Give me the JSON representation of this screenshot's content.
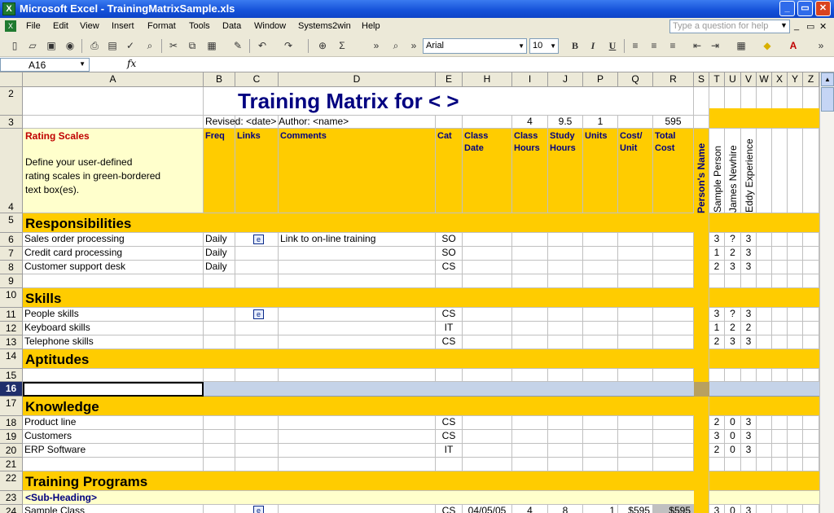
{
  "window": {
    "title": "Microsoft Excel - TrainingMatrixSample.xls"
  },
  "menu": {
    "items": [
      "File",
      "Edit",
      "View",
      "Insert",
      "Format",
      "Tools",
      "Data",
      "Window",
      "Systems2win",
      "Help"
    ],
    "help_placeholder": "Type a question for help"
  },
  "toolbar": {
    "font": "Arial",
    "size": "10",
    "bold": "B",
    "italic": "I",
    "underline": "U"
  },
  "formula_bar": {
    "name_box": "A16",
    "fx": "fx",
    "content": ""
  },
  "columns": [
    "A",
    "B",
    "C",
    "D",
    "E",
    "H",
    "I",
    "J",
    "P",
    "Q",
    "R",
    "S",
    "T",
    "U",
    "V",
    "W",
    "X",
    "Y",
    "Z"
  ],
  "sheet": {
    "title": "Training Matrix for < >",
    "revised": "Revised: <date>  Author: <name>",
    "totals_row": {
      "i": "4",
      "j": "9.5",
      "p": "1",
      "r": "595"
    },
    "rating_scales_title": "Rating Scales",
    "rating_scales_text": [
      "Define your user-defined",
      "rating scales in green-bordered",
      "text box(es)."
    ],
    "headers": {
      "freq": "Freq",
      "links": "Links",
      "comments": "Comments",
      "cat": "Cat",
      "class_date": "Class Date",
      "class_hours": "Class Hours",
      "study_hours": "Study Hours",
      "units": "Units",
      "cost_unit": "Cost/ Unit",
      "total_cost": "Total Cost"
    },
    "persons_label": "Person's Name",
    "persons": [
      "Sample Person",
      "James Newhire",
      "Eddy Experience"
    ],
    "sections": {
      "responsibilities": "Responsibilities",
      "skills": "Skills",
      "aptitudes": "Aptitudes",
      "knowledge": "Knowledge",
      "training": "Training Programs",
      "sub_heading": "<Sub-Heading>"
    },
    "rows": [
      {
        "num": "6",
        "name": "Sales order processing",
        "freq": "Daily",
        "link": true,
        "comment": "Link to on-line training",
        "cat": "SO",
        "t": "3",
        "u": "?",
        "v": "3"
      },
      {
        "num": "7",
        "name": "Credit card processing",
        "freq": "Daily",
        "link": false,
        "comment": "",
        "cat": "SO",
        "t": "1",
        "u": "2",
        "v": "3"
      },
      {
        "num": "8",
        "name": "Customer support desk",
        "freq": "Daily",
        "link": false,
        "comment": "",
        "cat": "CS",
        "t": "2",
        "u": "3",
        "v": "3"
      },
      {
        "num": "11",
        "name": "People skills",
        "freq": "",
        "link": true,
        "comment": "",
        "cat": "CS",
        "t": "3",
        "u": "?",
        "v": "3"
      },
      {
        "num": "12",
        "name": "Keyboard skills",
        "freq": "",
        "link": false,
        "comment": "",
        "cat": "IT",
        "t": "1",
        "u": "2",
        "v": "2"
      },
      {
        "num": "13",
        "name": "Telephone skills",
        "freq": "",
        "link": false,
        "comment": "",
        "cat": "CS",
        "t": "2",
        "u": "3",
        "v": "3"
      },
      {
        "num": "18",
        "name": "Product line",
        "freq": "",
        "link": false,
        "comment": "",
        "cat": "CS",
        "t": "2",
        "u": "0",
        "v": "3"
      },
      {
        "num": "19",
        "name": "Customers",
        "freq": "",
        "link": false,
        "comment": "",
        "cat": "CS",
        "t": "3",
        "u": "0",
        "v": "3"
      },
      {
        "num": "20",
        "name": "ERP Software",
        "freq": "",
        "link": false,
        "comment": "",
        "cat": "IT",
        "t": "2",
        "u": "0",
        "v": "3"
      }
    ],
    "row24": {
      "num": "24",
      "name": "Sample Class",
      "cat": "CS",
      "date": "04/05/05",
      "i": "4",
      "j": "8",
      "p": "1",
      "q": "$595",
      "r": "$595",
      "t": "3",
      "u": "0",
      "v": "3"
    },
    "row_numbers": [
      "2",
      "3",
      "4",
      "5",
      "9",
      "10",
      "14",
      "15",
      "16",
      "17",
      "21",
      "22",
      "23"
    ]
  }
}
